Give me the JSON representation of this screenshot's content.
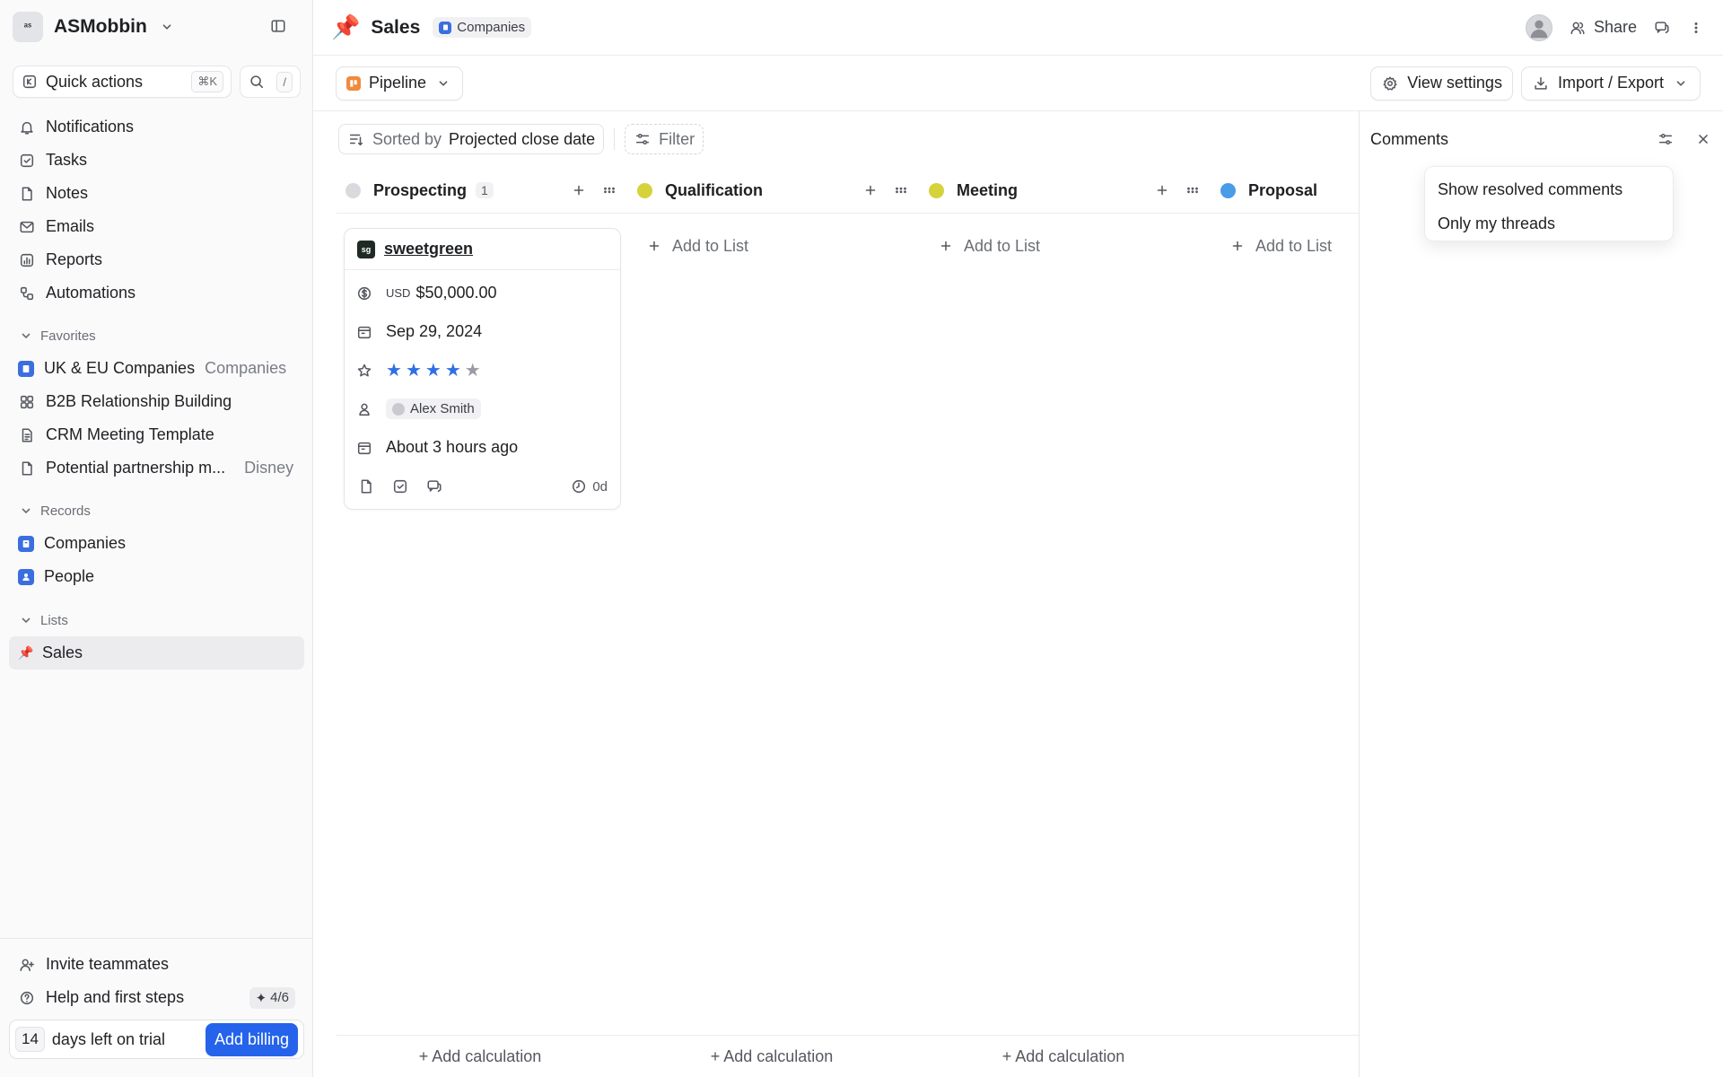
{
  "workspace": {
    "name": "ASMobbin",
    "logo_text": "ᵃˢ"
  },
  "quick_actions": {
    "label": "Quick actions",
    "shortcut": "⌘K",
    "search_shortcut": "/"
  },
  "nav": [
    {
      "label": "Notifications",
      "icon": "bell-icon"
    },
    {
      "label": "Tasks",
      "icon": "check-square-icon"
    },
    {
      "label": "Notes",
      "icon": "file-icon"
    },
    {
      "label": "Emails",
      "icon": "mail-icon"
    },
    {
      "label": "Reports",
      "icon": "bar-chart-icon"
    },
    {
      "label": "Automations",
      "icon": "workflow-icon"
    }
  ],
  "favorites": {
    "heading": "Favorites",
    "items": [
      {
        "label": "UK & EU Companies",
        "secondary": "Companies"
      },
      {
        "label": "B2B Relationship Building",
        "secondary": ""
      },
      {
        "label": "CRM Meeting Template",
        "secondary": ""
      },
      {
        "label": "Potential partnership m...",
        "secondary": "Disney"
      }
    ]
  },
  "records": {
    "heading": "Records",
    "items": [
      {
        "label": "Companies"
      },
      {
        "label": "People"
      }
    ]
  },
  "lists": {
    "heading": "Lists",
    "items": [
      {
        "label": "Sales"
      }
    ]
  },
  "bottom": {
    "invite": "Invite teammates",
    "help": "Help and first steps",
    "help_progress": "4/6",
    "trial_days": "14",
    "trial_text": "days left on trial",
    "billing_button": "Add billing"
  },
  "header": {
    "title": "Sales",
    "chip": "Companies",
    "share": "Share"
  },
  "viewbar": {
    "view_name": "Pipeline",
    "view_settings": "View settings",
    "import_export": "Import / Export"
  },
  "sortbar": {
    "sorted_by": "Sorted by",
    "sort_field": "Projected close date",
    "filter": "Filter"
  },
  "columns": [
    {
      "name": "Prospecting",
      "count": "1",
      "color": "#d9dadd"
    },
    {
      "name": "Qualification",
      "count": "",
      "color": "#d6d23a"
    },
    {
      "name": "Meeting",
      "count": "",
      "color": "#d6d23a"
    },
    {
      "name": "Proposal",
      "count": "",
      "color": "#4a9be8"
    }
  ],
  "card": {
    "title": "sweetgreen",
    "logo_text": "sg",
    "currency": "USD",
    "amount": "$50,000.00",
    "date": "Sep 29, 2024",
    "rating": 4,
    "rating_max": 5,
    "owner": "Alex Smith",
    "created": "About 3 hours ago",
    "age": "0d"
  },
  "add_to_list": "Add to List",
  "add_calculation": "+ Add calculation",
  "comments": {
    "title": "Comments",
    "menu": [
      "Show resolved comments",
      "Only my threads"
    ]
  },
  "colors": {
    "accent": "#2563eb",
    "star": "#2f6fe4",
    "star_empty": "#9a9ca3"
  }
}
